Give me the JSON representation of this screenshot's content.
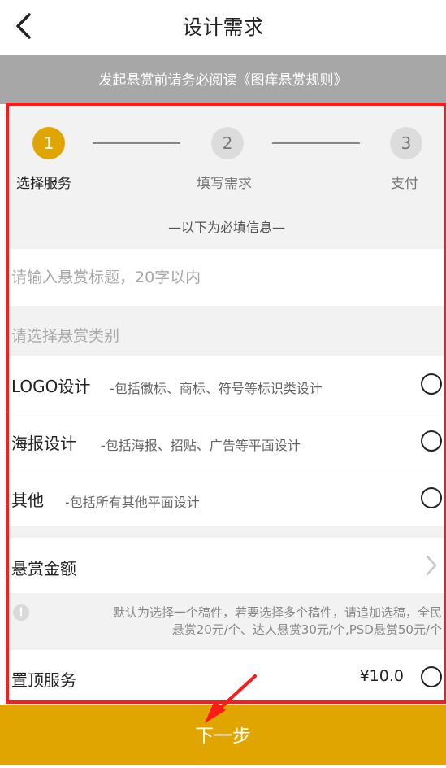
{
  "header": {
    "title": "设计需求",
    "back_icon": "chevron-left-icon"
  },
  "notice": {
    "text": "发起悬赏前请务必阅读《图痒悬赏规则》"
  },
  "steps": [
    {
      "number": "1",
      "label": "选择服务",
      "active": true
    },
    {
      "number": "2",
      "label": "填写需求",
      "active": false
    },
    {
      "number": "3",
      "label": "支付",
      "active": false
    }
  ],
  "form": {
    "required_hint": "—以下为必填信息—",
    "title_placeholder": "请输入悬赏标题，20字以内",
    "category_header": "请选择悬赏类别",
    "categories": [
      {
        "name": "LOGO设计",
        "desc": "-包括徽标、商标、符号等标识类设计",
        "selected": false
      },
      {
        "name": "海报设计",
        "desc": "-包括海报、招贴、广告等平面设计",
        "selected": false
      },
      {
        "name": "其他",
        "desc": "-包括所有其他平面设计",
        "selected": false
      }
    ],
    "amount_label": "悬赏金额",
    "info_icon": "exclamation-icon",
    "info_text_line1": "默认为选择一个稿件，若要选择多个稿件，请追加选稿，全民",
    "info_text_line2": "悬赏20元/个、达人悬赏30元/个,PSD悬赏50元/个",
    "top_service_label": "置顶服务",
    "top_service_price": "¥10.0"
  },
  "footer": {
    "next_label": "下一步"
  },
  "colors": {
    "accent": "#e0a500",
    "highlight_border": "#ff1a1a",
    "notice_bg": "#a7a7a7"
  }
}
